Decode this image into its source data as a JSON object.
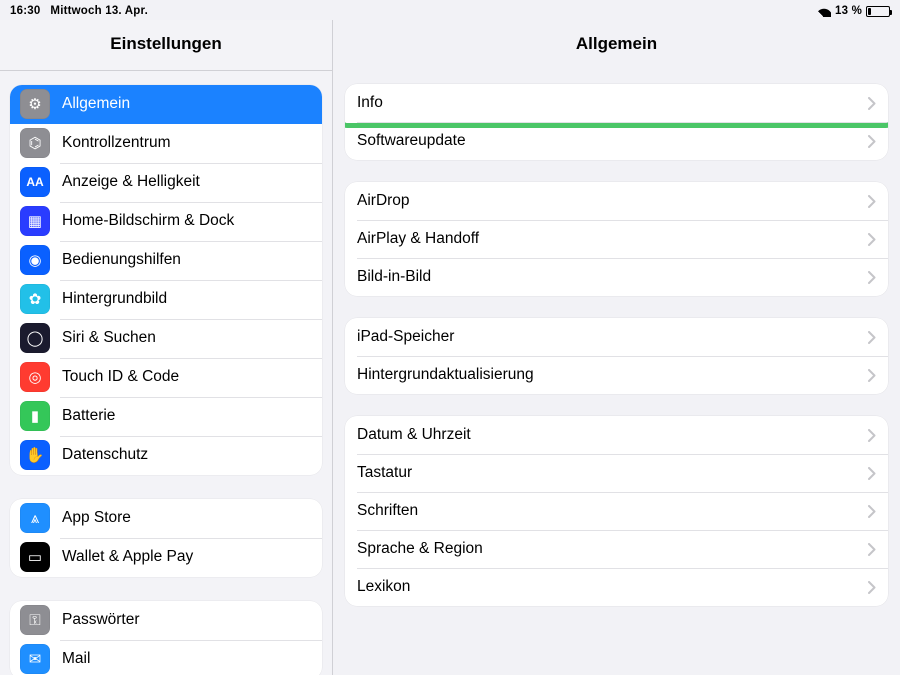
{
  "statusbar": {
    "time": "16:30",
    "date": "Mittwoch 13. Apr.",
    "battery_percent_text": "13 %"
  },
  "sidebar": {
    "title": "Einstellungen",
    "groups": [
      {
        "items": [
          {
            "id": "general",
            "label": "Allgemein",
            "icon_name": "gear-icon",
            "selected": true,
            "bg": "#8e8e93",
            "glyph": "⚙"
          },
          {
            "id": "controlcenter",
            "label": "Kontrollzentrum",
            "icon_name": "switches-icon",
            "selected": false,
            "bg": "#8e8e93",
            "glyph": "⌬"
          },
          {
            "id": "display",
            "label": "Anzeige & Helligkeit",
            "icon_name": "text-size-icon",
            "selected": false,
            "bg": "#0a60ff",
            "glyph": "AA"
          },
          {
            "id": "home",
            "label": "Home-Bildschirm & Dock",
            "icon_name": "apps-grid-icon",
            "selected": false,
            "bg": "#2a3cff",
            "glyph": "▦"
          },
          {
            "id": "accessibility",
            "label": "Bedienungshilfen",
            "icon_name": "accessibility-icon",
            "selected": false,
            "bg": "#0a60ff",
            "glyph": "◉"
          },
          {
            "id": "wallpaper",
            "label": "Hintergrundbild",
            "icon_name": "flower-icon",
            "selected": false,
            "bg": "#22c0e8",
            "glyph": "✿"
          },
          {
            "id": "siri",
            "label": "Siri & Suchen",
            "icon_name": "siri-icon",
            "selected": false,
            "bg": "#1b1b2e",
            "glyph": "◯"
          },
          {
            "id": "touchid",
            "label": "Touch ID & Code",
            "icon_name": "fingerprint-icon",
            "selected": false,
            "bg": "#ff3b30",
            "glyph": "◎"
          },
          {
            "id": "battery",
            "label": "Batterie",
            "icon_name": "battery-icon",
            "selected": false,
            "bg": "#34c759",
            "glyph": "▮"
          },
          {
            "id": "privacy",
            "label": "Datenschutz",
            "icon_name": "hand-icon",
            "selected": false,
            "bg": "#0a60ff",
            "glyph": "✋"
          }
        ]
      },
      {
        "items": [
          {
            "id": "appstore",
            "label": "App Store",
            "icon_name": "appstore-icon",
            "selected": false,
            "bg": "#1f8fff",
            "glyph": "⩓"
          },
          {
            "id": "wallet",
            "label": "Wallet & Apple Pay",
            "icon_name": "wallet-icon",
            "selected": false,
            "bg": "#000000",
            "glyph": "▭"
          }
        ]
      },
      {
        "items": [
          {
            "id": "passwords",
            "label": "Passwörter",
            "icon_name": "key-icon",
            "selected": false,
            "bg": "#8e8e93",
            "glyph": "⚿"
          },
          {
            "id": "mail",
            "label": "Mail",
            "icon_name": "mail-icon",
            "selected": false,
            "bg": "#1f8fff",
            "glyph": "✉"
          }
        ]
      }
    ]
  },
  "detail": {
    "title": "Allgemein",
    "groups": [
      {
        "rows": [
          {
            "id": "about",
            "label": "Info",
            "highlight": true
          },
          {
            "id": "softwareupdate",
            "label": "Softwareupdate",
            "highlight": false
          }
        ]
      },
      {
        "rows": [
          {
            "id": "airdrop",
            "label": "AirDrop"
          },
          {
            "id": "airplay",
            "label": "AirPlay & Handoff"
          },
          {
            "id": "pip",
            "label": "Bild-in-Bild"
          }
        ]
      },
      {
        "rows": [
          {
            "id": "storage",
            "label": "iPad-Speicher"
          },
          {
            "id": "bgrefresh",
            "label": "Hintergrundaktualisierung"
          }
        ]
      },
      {
        "rows": [
          {
            "id": "datetime",
            "label": "Datum & Uhrzeit"
          },
          {
            "id": "keyboard",
            "label": "Tastatur"
          },
          {
            "id": "fonts",
            "label": "Schriften"
          },
          {
            "id": "language",
            "label": "Sprache & Region"
          },
          {
            "id": "dict",
            "label": "Lexikon"
          }
        ]
      }
    ]
  }
}
